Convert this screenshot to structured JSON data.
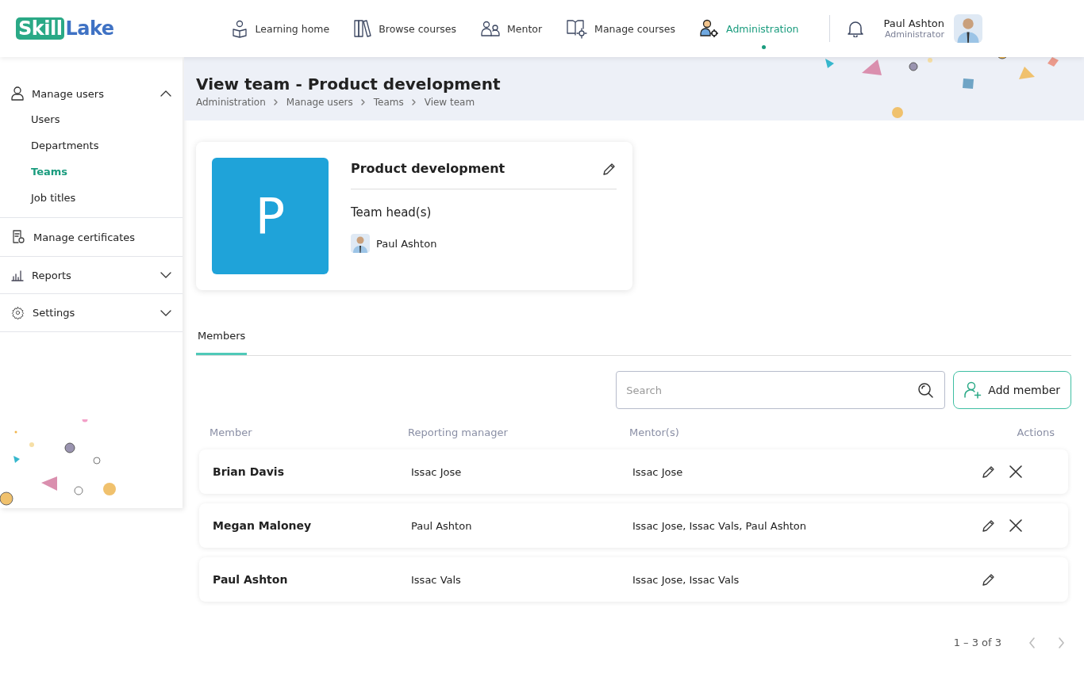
{
  "logo": {
    "part_1": "Skill",
    "part_2": "Lake"
  },
  "nav": [
    {
      "label": "Learning home",
      "selected": false
    },
    {
      "label": "Browse courses",
      "selected": false
    },
    {
      "label": "Mentor",
      "selected": false
    },
    {
      "label": "Manage courses",
      "selected": false
    },
    {
      "label": "Administration",
      "selected": true
    }
  ],
  "user": {
    "name": "Paul Ashton",
    "role": "Administrator"
  },
  "sidebar": [
    {
      "label": "Manage users",
      "expanded": true,
      "children": [
        {
          "label": "Users",
          "selected": false
        },
        {
          "label": "Departments",
          "selected": false
        },
        {
          "label": "Teams",
          "selected": true
        },
        {
          "label": "Job titles",
          "selected": false
        }
      ]
    },
    {
      "label": "Manage certificates"
    },
    {
      "label": "Reports",
      "expanded": false
    },
    {
      "label": "Settings",
      "expanded": false
    }
  ],
  "page": {
    "title": "View team - Product development",
    "breadcrumb": [
      "Administration",
      "Manage users",
      "Teams",
      "View team"
    ]
  },
  "team": {
    "initial": "P",
    "name": "Product development",
    "heads_label": "Team head(s)",
    "heads": [
      "Paul Ashton"
    ]
  },
  "tabs": [
    {
      "label": "Members",
      "selected": true
    }
  ],
  "search": {
    "placeholder": "Search"
  },
  "add_button": "Add member",
  "table": {
    "columns": [
      "Member",
      "Reporting manager",
      "Mentor(s)",
      "Actions"
    ],
    "rows": [
      {
        "member": "Brian Davis",
        "manager": "Issac Jose",
        "mentors": "Issac Jose",
        "removable": true
      },
      {
        "member": "Megan Maloney",
        "manager": "Paul Ashton",
        "mentors": "Issac Jose, Issac Vals, Paul Ashton",
        "removable": true
      },
      {
        "member": "Paul Ashton",
        "manager": "Issac Vals",
        "mentors": "Issac Jose, Issac Vals",
        "removable": false
      }
    ]
  },
  "pagination": {
    "range": "1 – 3 of 3",
    "prev_disabled": true,
    "next_disabled": true
  }
}
